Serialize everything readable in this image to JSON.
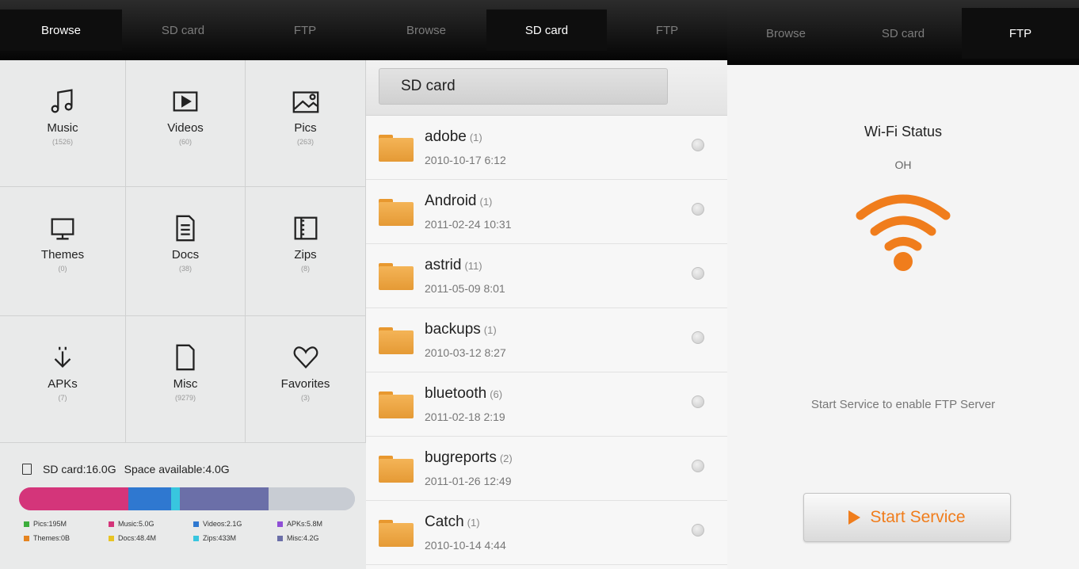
{
  "panels": {
    "browse": {
      "tabs": [
        "Browse",
        "SD card",
        "FTP"
      ],
      "active_tab": 0,
      "categories": [
        {
          "label": "Music",
          "count": "(1526)",
          "icon": "music-icon"
        },
        {
          "label": "Videos",
          "count": "(60)",
          "icon": "video-play-icon"
        },
        {
          "label": "Pics",
          "count": "(263)",
          "icon": "picture-icon"
        },
        {
          "label": "Themes",
          "count": "(0)",
          "icon": "monitor-icon"
        },
        {
          "label": "Docs",
          "count": "(38)",
          "icon": "document-icon"
        },
        {
          "label": "Zips",
          "count": "(8)",
          "icon": "zip-archive-icon"
        },
        {
          "label": "APKs",
          "count": "(7)",
          "icon": "download-arrow-icon"
        },
        {
          "label": "Misc",
          "count": "(9279)",
          "icon": "blank-file-icon"
        },
        {
          "label": "Favorites",
          "count": "(3)",
          "icon": "heart-icon"
        }
      ],
      "storage": {
        "sd_card": "SD card:16.0G",
        "space_available": "Space available:4.0G",
        "usage_bar": [
          {
            "label": "Music",
            "percent": 32.5,
            "color": "#d4357a"
          },
          {
            "label": "Videos",
            "percent": 12.7,
            "color": "#2f78d0"
          },
          {
            "label": "Zips",
            "percent": 2.6,
            "color": "#38c6df"
          },
          {
            "label": "Misc",
            "percent": 26.6,
            "color": "#6b6fa8"
          },
          {
            "label": "Free",
            "percent": 25.6,
            "color": "#c8ccd3"
          }
        ],
        "legend": [
          {
            "text": "Pics:195M",
            "color": "#3cad3c"
          },
          {
            "text": "Music:5.0G",
            "color": "#d4357a"
          },
          {
            "text": "Videos:2.1G",
            "color": "#2f78d0"
          },
          {
            "text": "APKs:5.8M",
            "color": "#8f4fd6"
          },
          {
            "text": "Themes:0B",
            "color": "#e58420"
          },
          {
            "text": "Docs:48.4M",
            "color": "#e8c424"
          },
          {
            "text": "Zips:433M",
            "color": "#38c6df"
          },
          {
            "text": "Misc:4.2G",
            "color": "#6b6fa8"
          }
        ]
      }
    },
    "sdcard": {
      "tabs": [
        "Browse",
        "SD card",
        "FTP"
      ],
      "active_tab": 1,
      "breadcrumb": "SD card",
      "files": [
        {
          "name": "adobe",
          "count": "(1)",
          "date": "2010-10-17 6:12"
        },
        {
          "name": "Android",
          "count": "(1)",
          "date": "2011-02-24 10:31"
        },
        {
          "name": "astrid",
          "count": "(11)",
          "date": "2011-05-09 8:01"
        },
        {
          "name": "backups",
          "count": "(1)",
          "date": "2010-03-12 8:27"
        },
        {
          "name": "bluetooth",
          "count": "(6)",
          "date": "2011-02-18 2:19"
        },
        {
          "name": "bugreports",
          "count": "(2)",
          "date": "2011-01-26 12:49"
        },
        {
          "name": "Catch",
          "count": "(1)",
          "date": "2010-10-14 4:44"
        }
      ]
    },
    "ftp": {
      "tabs": [
        "Browse",
        "SD card",
        "FTP"
      ],
      "active_tab": 2,
      "wifi_title": "Wi-Fi Status",
      "wifi_status": "OH",
      "hint": "Start Service to enable FTP Server",
      "button_label": "Start Service",
      "accent": "#f07d1c"
    }
  }
}
